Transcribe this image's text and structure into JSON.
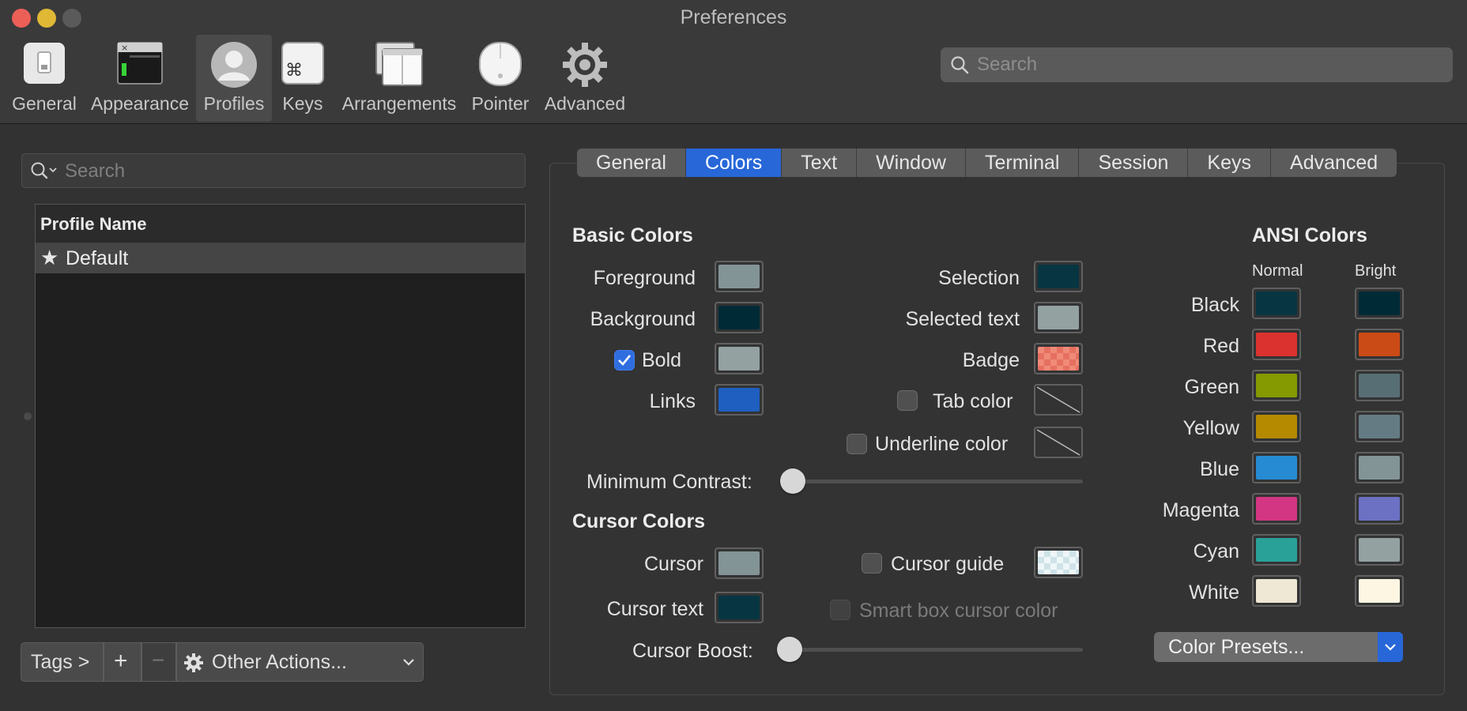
{
  "window": {
    "title": "Preferences"
  },
  "toolbar": {
    "items": [
      {
        "label": "General",
        "icon": "switch-icon"
      },
      {
        "label": "Appearance",
        "icon": "window-icon"
      },
      {
        "label": "Profiles",
        "icon": "user-icon"
      },
      {
        "label": "Keys",
        "icon": "command-key-icon"
      },
      {
        "label": "Arrangements",
        "icon": "windows-stack-icon"
      },
      {
        "label": "Pointer",
        "icon": "mouse-icon"
      },
      {
        "label": "Advanced",
        "icon": "gear-icon"
      }
    ],
    "selected": "Profiles",
    "search_placeholder": "Search"
  },
  "profiles": {
    "search_placeholder": "Search",
    "column_header": "Profile Name",
    "rows": [
      {
        "name": "Default",
        "is_default": true
      }
    ],
    "buttons": {
      "tags": "Tags >",
      "add": "+",
      "remove": "−",
      "other_actions": "Other Actions..."
    }
  },
  "tabs": {
    "items": [
      "General",
      "Colors",
      "Text",
      "Window",
      "Terminal",
      "Session",
      "Keys",
      "Advanced"
    ],
    "selected": "Colors"
  },
  "basic_colors": {
    "heading": "Basic Colors",
    "foreground": {
      "label": "Foreground",
      "color": "#839496"
    },
    "background": {
      "label": "Background",
      "color": "#002b36"
    },
    "bold": {
      "label": "Bold",
      "checked": true,
      "color": "#93a1a1"
    },
    "links": {
      "label": "Links",
      "color": "#1f5fbf"
    },
    "selection": {
      "label": "Selection",
      "color": "#073642"
    },
    "selected_text": {
      "label": "Selected text",
      "color": "#93a1a1"
    },
    "badge": {
      "label": "Badge",
      "color": "#f08a78"
    },
    "tab_color": {
      "label": "Tab color",
      "checked": false
    },
    "underline_color": {
      "label": "Underline color",
      "checked": false
    },
    "minimum_contrast": {
      "label": "Minimum Contrast:",
      "value": 0
    }
  },
  "cursor_colors": {
    "heading": "Cursor Colors",
    "cursor": {
      "label": "Cursor",
      "color": "#839496"
    },
    "cursor_text": {
      "label": "Cursor text",
      "color": "#073642"
    },
    "cursor_guide": {
      "label": "Cursor guide",
      "checked": false
    },
    "smart_box": {
      "label": "Smart box cursor color",
      "checked": false,
      "enabled": false
    },
    "cursor_boost": {
      "label": "Cursor Boost:",
      "value": 0
    }
  },
  "ansi_colors": {
    "heading": "ANSI Colors",
    "normal_header": "Normal",
    "bright_header": "Bright",
    "rows": [
      {
        "label": "Black",
        "normal": "#073642",
        "bright": "#002b36"
      },
      {
        "label": "Red",
        "normal": "#dc322f",
        "bright": "#cb4b16"
      },
      {
        "label": "Green",
        "normal": "#859900",
        "bright": "#586e75"
      },
      {
        "label": "Yellow",
        "normal": "#b58900",
        "bright": "#657b83"
      },
      {
        "label": "Blue",
        "normal": "#268bd2",
        "bright": "#839496"
      },
      {
        "label": "Magenta",
        "normal": "#d33682",
        "bright": "#6c71c4"
      },
      {
        "label": "Cyan",
        "normal": "#2aa198",
        "bright": "#93a1a1"
      },
      {
        "label": "White",
        "normal": "#eee8d5",
        "bright": "#fdf6e3"
      }
    ]
  },
  "presets": {
    "label": "Color Presets..."
  },
  "colors": {
    "accent": "#2767d8",
    "close": "#ec5f57",
    "minimize": "#e0b835",
    "zoom": "#5a5a5a"
  }
}
